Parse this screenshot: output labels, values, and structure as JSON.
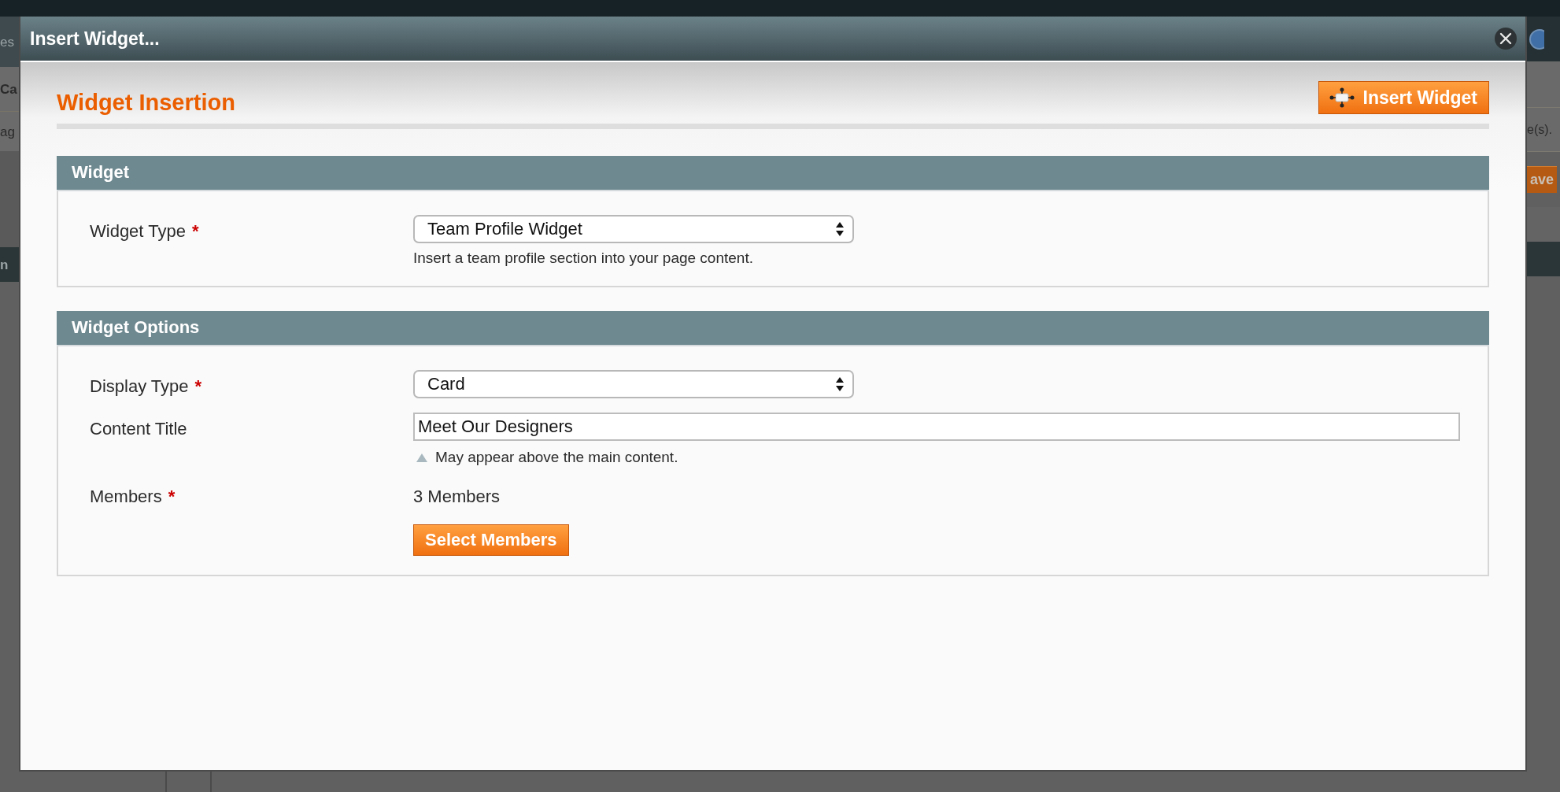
{
  "background": {
    "left_fragments": [
      "es",
      "Ca",
      "ag",
      "n"
    ],
    "right_fragments": [
      "e(s).",
      "ave"
    ]
  },
  "dialog": {
    "title": "Insert Widget...",
    "heading": "Widget Insertion",
    "insert_button": "Insert Widget"
  },
  "sections": [
    {
      "title": "Widget",
      "fields": [
        {
          "kind": "select",
          "label": "Widget Type",
          "required_mark": "*",
          "value": "Team Profile Widget",
          "note": "Insert a team profile section into your page content."
        }
      ]
    },
    {
      "title": "Widget Options",
      "fields": [
        {
          "kind": "select",
          "label": "Display Type",
          "required_mark": "*",
          "value": "Card"
        },
        {
          "kind": "text",
          "label": "Content Title",
          "value": "Meet Our Designers",
          "hint": "May appear above the main content."
        },
        {
          "kind": "picker",
          "label": "Members",
          "required_mark": "*",
          "value": "3 Members",
          "button": "Select Members"
        }
      ]
    }
  ]
}
